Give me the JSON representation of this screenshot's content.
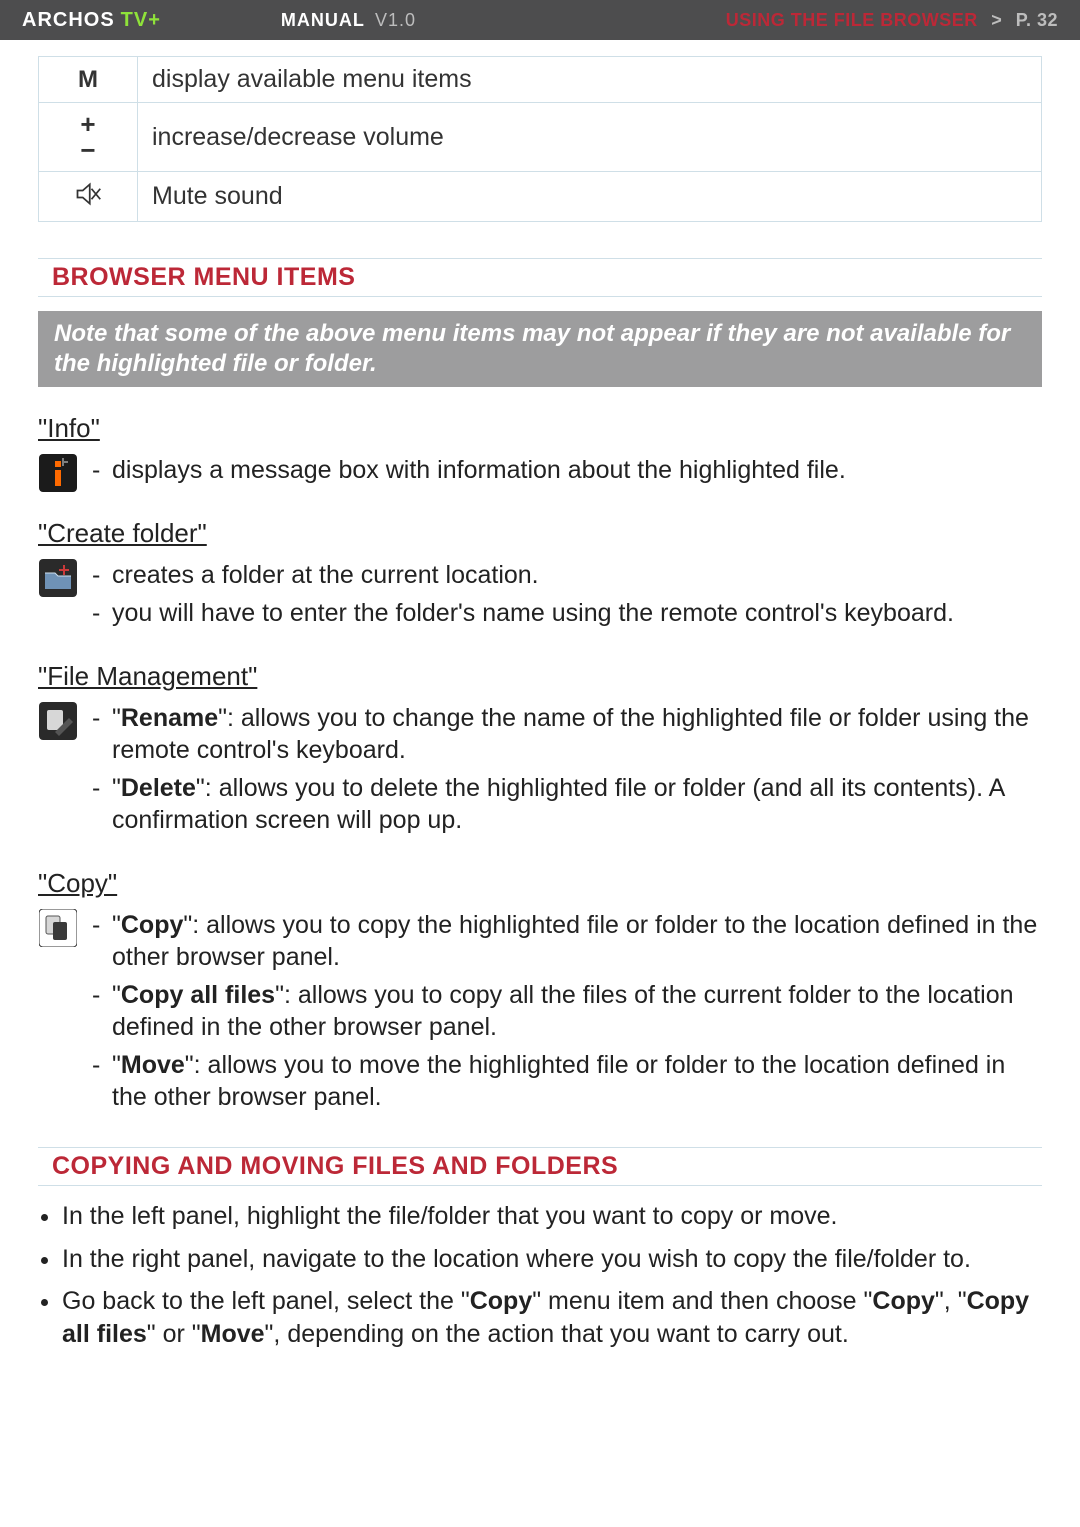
{
  "header": {
    "brand_main": "ARCHOS",
    "brand_sub": "TV+",
    "manual_label": "MANUAL",
    "manual_version": "V1.0",
    "crumb_title": "USING THE FILE BROWSER",
    "crumb_sep": ">",
    "crumb_page": "P. 32"
  },
  "keytable": [
    {
      "icon": "M",
      "desc": "display available menu items"
    },
    {
      "icon": "pm",
      "desc": "increase/decrease volume"
    },
    {
      "icon": "mute",
      "desc": "Mute sound"
    }
  ],
  "sections": {
    "browser_menu": {
      "heading": "BROWSER MENU ITEMS",
      "note": "Note that some of the above menu items may not appear if they are not available for the highlighted file or folder.",
      "items": {
        "info": {
          "title": "\"Info\"",
          "bullets": [
            "displays a message box with information about the highlighted file."
          ]
        },
        "create_folder": {
          "title": "\"Create folder\"",
          "bullets": [
            "creates a folder at the current location.",
            "you will have to enter the folder's name using the remote control's keyboard."
          ]
        },
        "file_mgmt": {
          "title": "\"File Management\"",
          "bullets_html": [
            "\"<b>Rename</b>\": allows you to change the name of the highlighted file or folder using the remote control's keyboard.",
            "\"<b>Delete</b>\": allows you to delete the highlighted file or folder (and all its contents). A confirmation screen will pop up."
          ]
        },
        "copy": {
          "title": "\"Copy\"",
          "bullets_html": [
            "\"<b>Copy</b>\": allows you to copy the highlighted file or folder to the location defined in the other browser panel.",
            "\"<b>Copy all files</b>\": allows you to copy all the files of the current folder to the location defined in the other browser panel.",
            "\"<b>Move</b>\": allows you to move the highlighted file or folder to the location defined in the other browser panel."
          ]
        }
      }
    },
    "copying": {
      "heading": "COPYING AND MOVING FILES AND FOLDERS",
      "steps_html": [
        "In the left panel, highlight the file/folder that you want to copy or move.",
        "In the right panel, navigate to the location where you wish to copy the file/folder to.",
        "Go back to the left panel, select the \"<b>Copy</b>\" menu item and then choose \"<b>Copy</b>\", \"<b>Copy all files</b>\" or \"<b>Move</b>\", depending on the action that you want to carry out."
      ]
    }
  }
}
